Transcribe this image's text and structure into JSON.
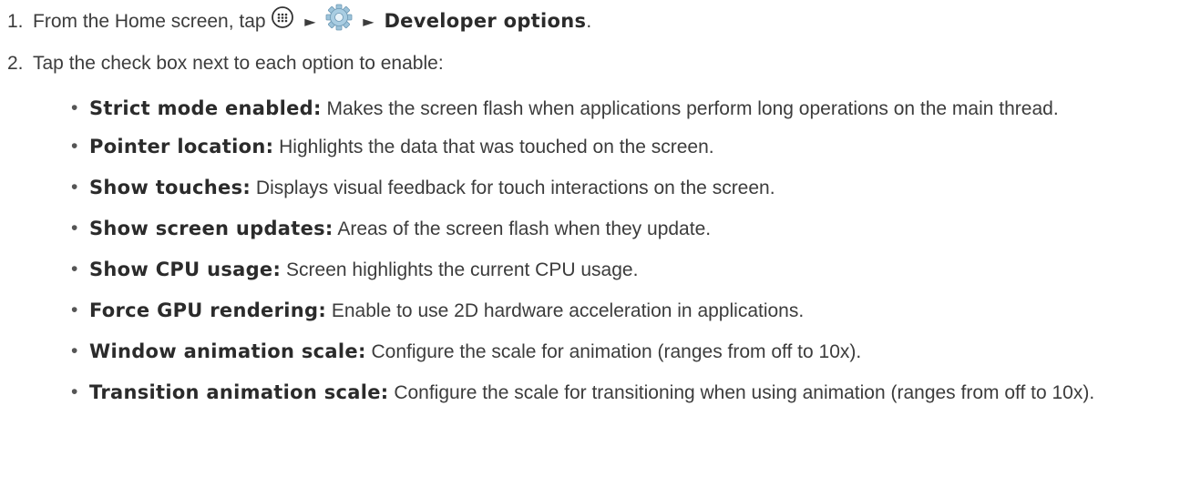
{
  "step1": {
    "number": "1.",
    "text": "From the Home screen, tap",
    "separator": "►",
    "apps_icon": "apps-grid-icon",
    "settings_icon": "settings-gear-icon",
    "destination": "Developer options",
    "period": "."
  },
  "step2": {
    "number": "2.",
    "text": "Tap the check box next to each option to enable:"
  },
  "options": [
    {
      "term": "Strict mode enabled:",
      "desc": "Makes the screen flash when applications perform long operations on the main thread."
    },
    {
      "term": "Pointer location:",
      "desc": "Highlights the data that was touched on the screen."
    },
    {
      "term": "Show touches:",
      "desc": "Displays visual feedback for touch interactions on the screen."
    },
    {
      "term": "Show screen updates:",
      "desc": "Areas of the screen flash when they update."
    },
    {
      "term": "Show CPU usage:",
      "desc": "Screen highlights the current CPU usage."
    },
    {
      "term": "Force GPU rendering:",
      "desc": "Enable to use 2D hardware acceleration in applications."
    },
    {
      "term": "Window animation scale:",
      "desc": "Configure the scale for animation (ranges from off to 10x)."
    },
    {
      "term": "Transition animation scale:",
      "desc": "Configure the scale for transitioning when using animation (ranges from off to 10x)."
    }
  ],
  "bullet_char": "•",
  "colors": {
    "text": "#3c3c3c",
    "bold": "#2b2b2b",
    "gear": "#8fb7cf"
  }
}
